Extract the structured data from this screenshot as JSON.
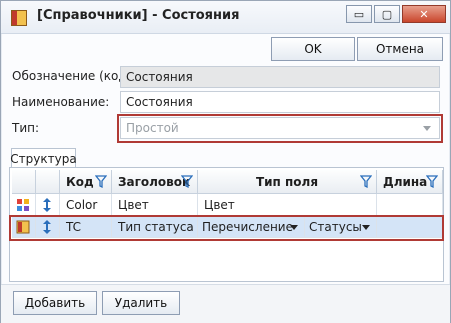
{
  "window": {
    "title": "[Справочники] - Состояния",
    "controls": {
      "minimize": "▭",
      "maximize": "▢",
      "close": "✕"
    }
  },
  "toolbar": {
    "ok_label": "OK",
    "cancel_label": "Отмена"
  },
  "form": {
    "code_label": "Обозначение (код):",
    "code_value": "Состояния",
    "name_label": "Наименование:",
    "name_value": "Состояния",
    "type_label": "Тип:",
    "type_value": "Простой"
  },
  "tabs": [
    {
      "label": "Структура"
    }
  ],
  "grid": {
    "columns": [
      {
        "label": "Код"
      },
      {
        "label": "Заголовок"
      },
      {
        "label": "Тип поля"
      },
      {
        "label": "Длина"
      }
    ],
    "rows": [
      {
        "code": "Color",
        "title": "Цвет",
        "field_type": "Цвет",
        "field_type2": "",
        "length": "",
        "icon": "palette-dots-icon",
        "selected": false
      },
      {
        "code": "TC",
        "title": "Тип статуса",
        "field_type": "Перечисление",
        "field_type2": "Статусы",
        "length": "",
        "icon": "book-icon",
        "selected": true
      }
    ]
  },
  "footer": {
    "add_label": "Добавить",
    "delete_label": "Удалить"
  },
  "colors": {
    "highlight_outline": "#b03a35",
    "selected_row": "#d4e4f7",
    "accent_blue": "#2a6ebb"
  }
}
